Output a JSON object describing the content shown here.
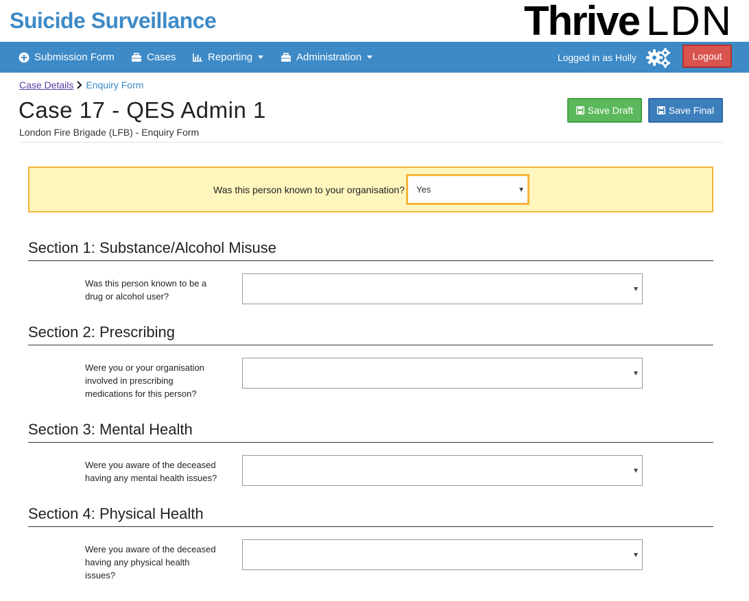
{
  "app": {
    "title": "Suicide Surveillance",
    "brand_bold": "Thrive",
    "brand_light": "LDN"
  },
  "nav": {
    "items": [
      {
        "label": "Submission Form",
        "icon": "plus-circle-icon",
        "dropdown": false
      },
      {
        "label": "Cases",
        "icon": "briefcase-icon",
        "dropdown": false
      },
      {
        "label": "Reporting",
        "icon": "bar-chart-icon",
        "dropdown": true
      },
      {
        "label": "Administration",
        "icon": "briefcase-icon",
        "dropdown": true
      }
    ],
    "logged_in": "Logged in as Holly",
    "logout_label": "Logout"
  },
  "breadcrumb": {
    "parent": "Case Details",
    "current": "Enquiry Form"
  },
  "page": {
    "title": "Case 17 - QES Admin 1",
    "subtitle": "London Fire Brigade (LFB) - Enquiry Form"
  },
  "actions": {
    "save_draft": "Save Draft",
    "save_final": "Save Final"
  },
  "known": {
    "question": "Was this person known to your organisation?",
    "value": "Yes"
  },
  "sections": [
    {
      "title": "Section 1: Substance/Alcohol Misuse",
      "question_lines": [
        "Was this person known to be a",
        "drug or alcohol user?"
      ],
      "value": ""
    },
    {
      "title": "Section 2: Prescribing",
      "question_lines": [
        "Were you or your organisation",
        "involved in prescribing",
        "medications for this person?"
      ],
      "value": ""
    },
    {
      "title": "Section 3: Mental Health",
      "question_lines": [
        "Were you aware of the deceased",
        "having any mental health issues?"
      ],
      "value": ""
    },
    {
      "title": "Section 4: Physical Health",
      "question_lines": [
        "Were you aware of the deceased",
        "having any physical health",
        "issues?"
      ],
      "value": ""
    }
  ],
  "colors": {
    "primary": "#3d8ac7",
    "success": "#5cb85c",
    "danger": "#d9534f",
    "highlight_bg": "#fff6bd",
    "highlight_border": "#f4b43a"
  }
}
